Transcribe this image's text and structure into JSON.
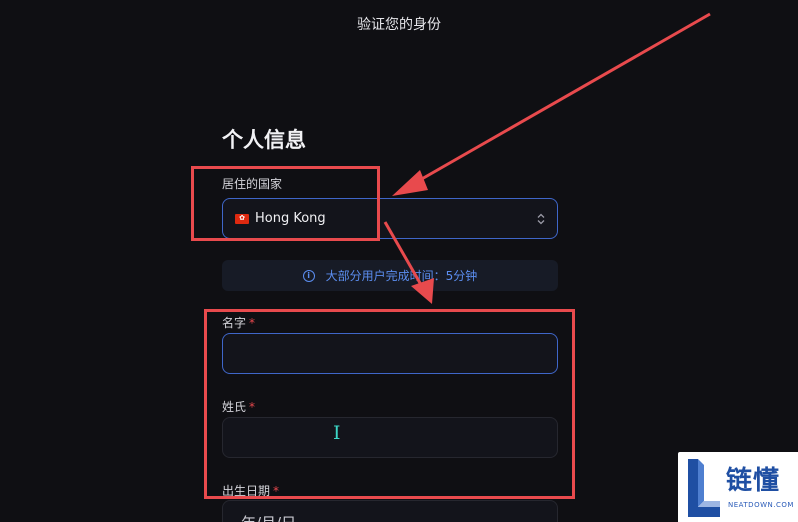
{
  "header": {
    "title": "验证您的身份"
  },
  "section": {
    "title": "个人信息"
  },
  "country": {
    "label": "居住的国家",
    "flag_glyph": "✿",
    "value": "Hong Kong"
  },
  "info": {
    "icon_glyph": "i",
    "text": "大部分用户完成时间：5分钟"
  },
  "first_name": {
    "label": "名字",
    "required_mark": "*",
    "value": ""
  },
  "last_name": {
    "label": "姓氏",
    "required_mark": "*",
    "value": ""
  },
  "birth_date": {
    "label": "出生日期",
    "required_mark": "*",
    "placeholder": "年/月/日"
  },
  "cursor": {
    "glyph": "I"
  },
  "watermark": {
    "brand": "链懂",
    "domain": "NEATDOWN.COM"
  },
  "colors": {
    "background": "#0f0f13",
    "accent_border": "#3f66c9",
    "info_text": "#5b8def",
    "required": "#e5484d",
    "annotation": "#e84a4d"
  },
  "icons": {
    "flag": "hong-kong-flag-icon",
    "chevron": "chevron-up-down-icon",
    "info": "info-circle-icon",
    "cursor": "text-cursor-icon"
  }
}
